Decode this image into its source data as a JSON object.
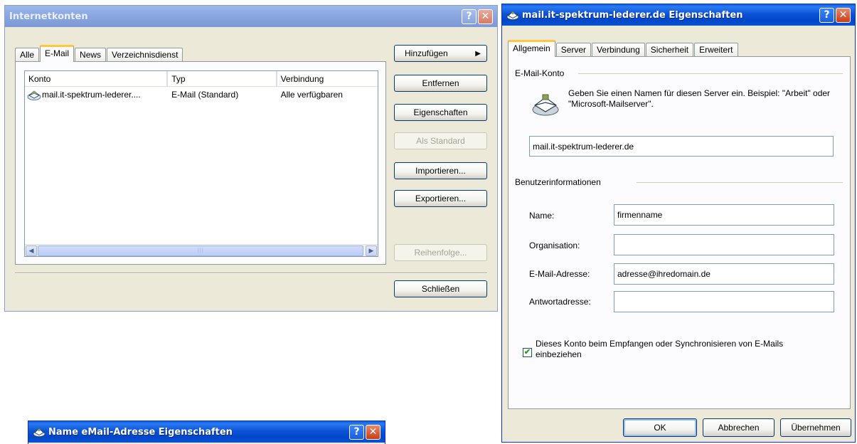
{
  "internetkonten": {
    "title": "Internetkonten",
    "help_glyph": "?",
    "close_glyph": "✕",
    "tabs": [
      "Alle",
      "E-Mail",
      "News",
      "Verzeichnisdienst"
    ],
    "active_tab": "E-Mail",
    "columns": [
      "Konto",
      "Typ",
      "Verbindung"
    ],
    "rows": [
      {
        "konto": "mail.it-spektrum-lederer....",
        "typ": "E-Mail (Standard)",
        "verbindung": "Alle verfügbaren"
      }
    ],
    "scroll_left": "◀",
    "scroll_right": "▶",
    "buttons": {
      "hinzufuegen": "Hinzufügen",
      "hinzufuegen_arrow": "▶",
      "entfernen": "Entfernen",
      "eigenschaften": "Eigenschaften",
      "als_standard": "Als Standard",
      "importieren": "Importieren...",
      "exportieren": "Exportieren...",
      "reihenfolge": "Reihenfolge...",
      "schliessen": "Schließen"
    }
  },
  "eigenschaften": {
    "title": "mail.it-spektrum-lederer.de Eigenschaften",
    "help_glyph": "?",
    "close_glyph": "✕",
    "tabs": [
      "Allgemein",
      "Server",
      "Verbindung",
      "Sicherheit",
      "Erweitert"
    ],
    "active_tab": "Allgemein",
    "group_mail": "E-Mail-Konto",
    "hint": "Geben Sie einen Namen für diesen Server ein. Beispiel: \"Arbeit\" oder \"Microsoft-Mailserver\".",
    "account_name": "mail.it-spektrum-lederer.de",
    "group_user": "Benutzerinformationen",
    "name_label": "Name:",
    "name_value": "firmenname",
    "org_label": "Organisation:",
    "org_value": "",
    "email_label": "E-Mail-Adresse:",
    "email_value": "adresse@ihredomain.de",
    "reply_label": "Antwortadresse:",
    "reply_value": "",
    "checkbox_checked": true,
    "checkbox_mark": "✔",
    "checkbox_label": "Dieses Konto beim Empfangen oder Synchronisieren von E-Mails einbeziehen",
    "buttons": {
      "ok": "OK",
      "abbrechen": "Abbrechen",
      "uebernehmen": "Übernehmen"
    }
  },
  "third_window": {
    "title": "Name eMail-Adresse Eigenschaften",
    "help_glyph": "?",
    "close_glyph": "✕"
  },
  "colors": {
    "title_active": "#0853d9",
    "title_inactive": "#8aa7df",
    "dialog_bg": "#ece9d8",
    "tab_highlight": "#ffc83c",
    "check_green": "#21a121"
  },
  "icons": [
    "account-icon",
    "help-icon",
    "close-icon",
    "envelope-icon",
    "checkbox-icon"
  ]
}
